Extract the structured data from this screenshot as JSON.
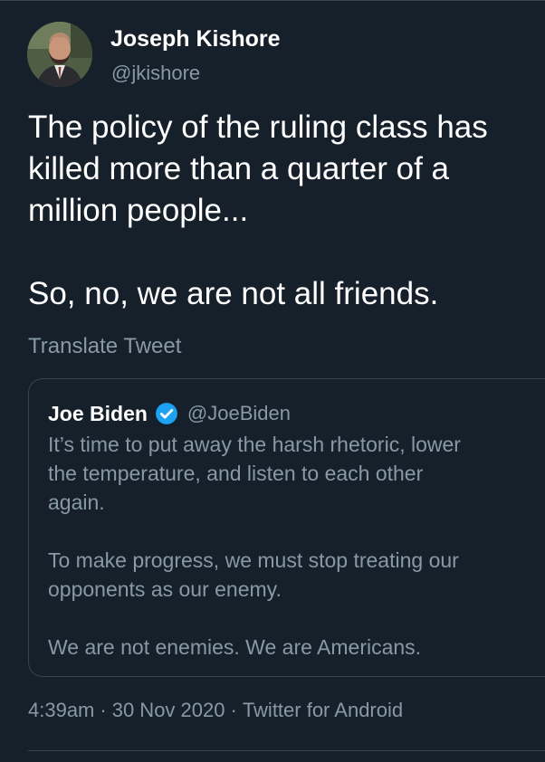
{
  "author": {
    "display_name": "Joseph Kishore",
    "handle": "@jkishore"
  },
  "tweet": {
    "lines": [
      "The policy of the ruling class has",
      "killed more than a quarter of a",
      "million people...",
      "So, no, we are not all friends."
    ],
    "translate_label": "Translate Tweet"
  },
  "quoted_tweet": {
    "display_name": "Joe Biden",
    "verified_icon": "verified-badge-icon",
    "handle": "@JoeBiden",
    "lines": [
      "It’s time to put away the harsh rhetoric, lower",
      "the temperature, and listen to each other",
      "again.",
      "To make progress, we must stop treating our",
      "opponents as our enemy.",
      "We are not enemies. We are Americans."
    ]
  },
  "meta": {
    "time": "4:39am",
    "separator": "·",
    "date": "30 Nov 2020",
    "source": "Twitter for Android"
  },
  "colors": {
    "background": "#15202b",
    "primary_text": "#ffffff",
    "secondary_text": "#8899a6",
    "border": "#38444d",
    "verified_blue": "#1da1f2"
  }
}
